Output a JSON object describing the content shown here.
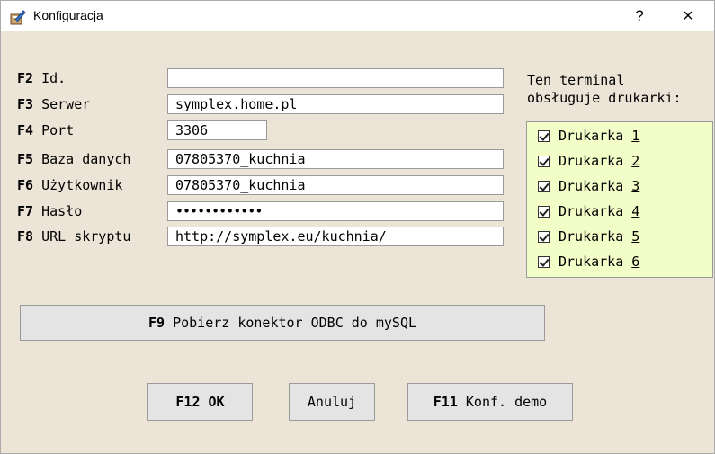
{
  "window": {
    "title": "Konfiguracja",
    "help_label": "?",
    "close_label": "×"
  },
  "form": {
    "fields": [
      {
        "key": "F2",
        "label": "Id.",
        "value": ""
      },
      {
        "key": "F3",
        "label": "Serwer",
        "value": "symplex.home.pl"
      },
      {
        "key": "F4",
        "label": "Port",
        "value": "3306"
      },
      {
        "key": "F5",
        "label": "Baza danych",
        "value": "07805370_kuchnia"
      },
      {
        "key": "F6",
        "label": "Użytkownik",
        "value": "07805370_kuchnia"
      },
      {
        "key": "F7",
        "label": "Hasło",
        "value": "••••••••••••"
      },
      {
        "key": "F8",
        "label": "URL skryptu",
        "value": "http://symplex.eu/kuchnia/"
      }
    ]
  },
  "printers": {
    "heading_line1": "Ten terminal",
    "heading_line2": "obsługuje drukarki:",
    "items": [
      {
        "label": "Drukarka",
        "number": "1",
        "checked": true
      },
      {
        "label": "Drukarka",
        "number": "2",
        "checked": true
      },
      {
        "label": "Drukarka",
        "number": "3",
        "checked": true
      },
      {
        "label": "Drukarka",
        "number": "4",
        "checked": true
      },
      {
        "label": "Drukarka",
        "number": "5",
        "checked": true
      },
      {
        "label": "Drukarka",
        "number": "6",
        "checked": true
      }
    ]
  },
  "buttons": {
    "odbc_key": "F9",
    "odbc_label": "Pobierz konektor ODBC do mySQL",
    "ok_key": "F12",
    "ok_label": "OK",
    "cancel_label": "Anuluj",
    "demo_key": "F11",
    "demo_label": "Konf. demo"
  },
  "colors": {
    "dialog_bg": "#ece5d7",
    "printers_bg": "#f2fdc7",
    "button_bg": "#e4e4e4"
  }
}
